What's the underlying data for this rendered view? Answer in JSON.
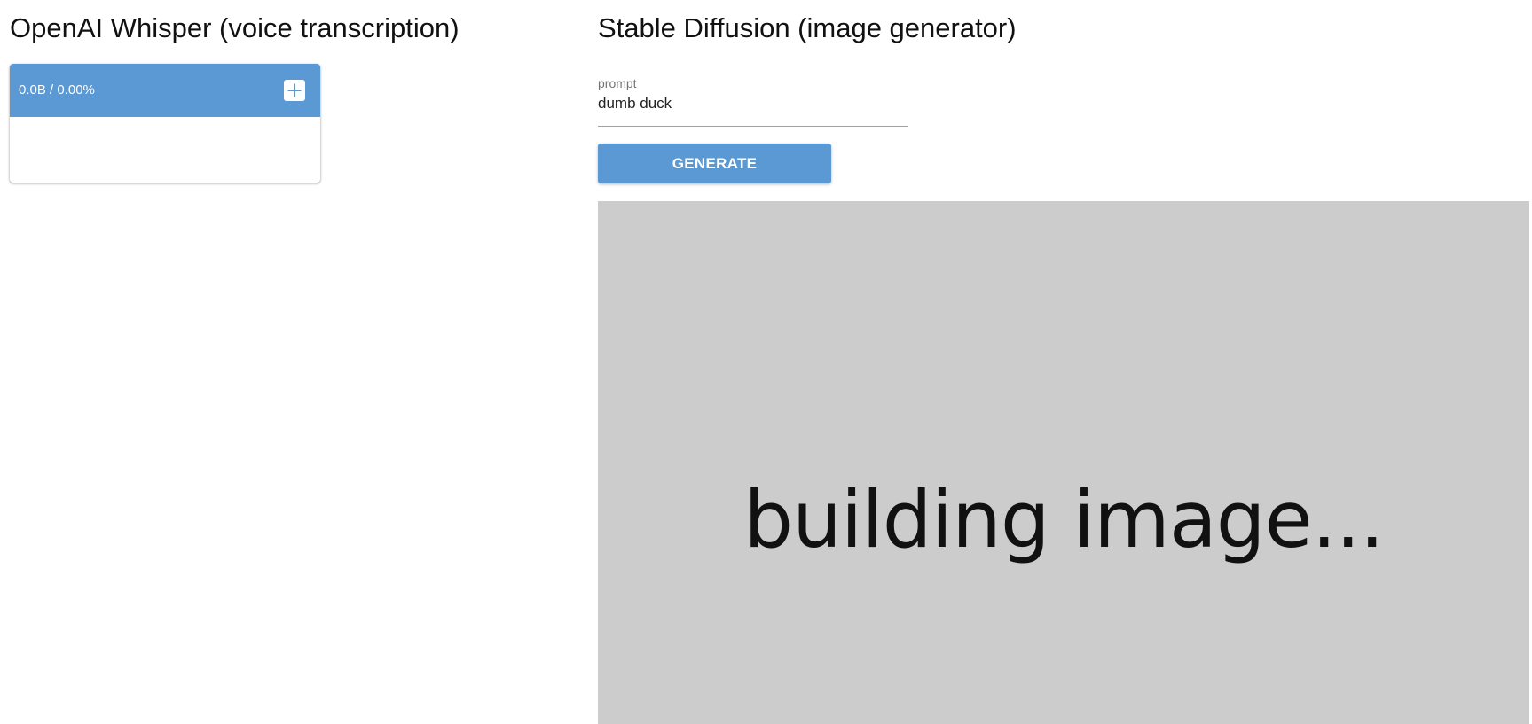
{
  "whisper": {
    "title": "OpenAI Whisper (voice transcription)",
    "card": {
      "progress_text": "0.0B / 0.00%",
      "add_icon": "plus-icon",
      "header_color": "#5a99d4"
    }
  },
  "stable_diffusion": {
    "title": "Stable Diffusion (image generator)",
    "prompt": {
      "label": "prompt",
      "value": "dumb duck"
    },
    "generate_label": "GENERATE",
    "image_area": {
      "status_text": "building image...",
      "background_color": "#cccccc"
    }
  },
  "accent_color": "#5a99d4"
}
